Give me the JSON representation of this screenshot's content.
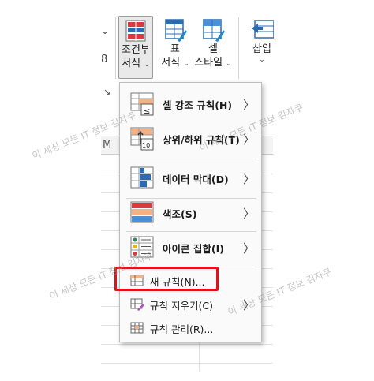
{
  "ribbon": {
    "conditional_format": {
      "line1": "조건부",
      "line2": "서식",
      "chevron": "⌄",
      "icon": "conditional-format-icon"
    },
    "format_table": {
      "line1": "표",
      "line2": "서식",
      "chevron": "⌄",
      "icon": "format-table-icon"
    },
    "cell_style": {
      "line1": "셀",
      "line2": "스타일",
      "chevron": "⌄",
      "icon": "cell-style-icon"
    },
    "insert": {
      "line1": "삽입",
      "chevron": "⌄",
      "icon": "insert-icon"
    },
    "left_chevron": "⌄",
    "left_mark": "8",
    "launcher": "↘"
  },
  "sheet": {
    "column_letter": "M"
  },
  "menu": {
    "items": [
      {
        "label": "셀 강조 규칙(H)",
        "icon": "highlight-cells-rules-icon",
        "has_submenu": true,
        "arrow": "〉"
      },
      {
        "label": "상위/하위 규칙(T)",
        "icon": "top-bottom-rules-icon",
        "has_submenu": true,
        "arrow": "〉"
      },
      {
        "label": "데이터 막대(D)",
        "icon": "data-bars-icon",
        "has_submenu": true,
        "arrow": "〉"
      },
      {
        "label": "색조(S)",
        "icon": "color-scales-icon",
        "has_submenu": true,
        "arrow": "〉"
      },
      {
        "label": "아이콘 집합(I)",
        "icon": "icon-sets-icon",
        "has_submenu": true,
        "arrow": "〉"
      },
      {
        "label": "새 규칙(N)...",
        "icon": "new-rule-icon",
        "has_submenu": false
      },
      {
        "label": "규칙 지우기(C)",
        "icon": "clear-rules-icon",
        "has_submenu": true,
        "arrow": "〉"
      },
      {
        "label": "규칙 관리(R)...",
        "icon": "manage-rules-icon",
        "has_submenu": false
      }
    ]
  },
  "watermark": {
    "text": "이 세상 모든 IT 정보 김자쿠"
  },
  "colors": {
    "highlight": "#e0131b",
    "accent_blue": "#2b6cb0",
    "accent_red": "#d9393f"
  }
}
